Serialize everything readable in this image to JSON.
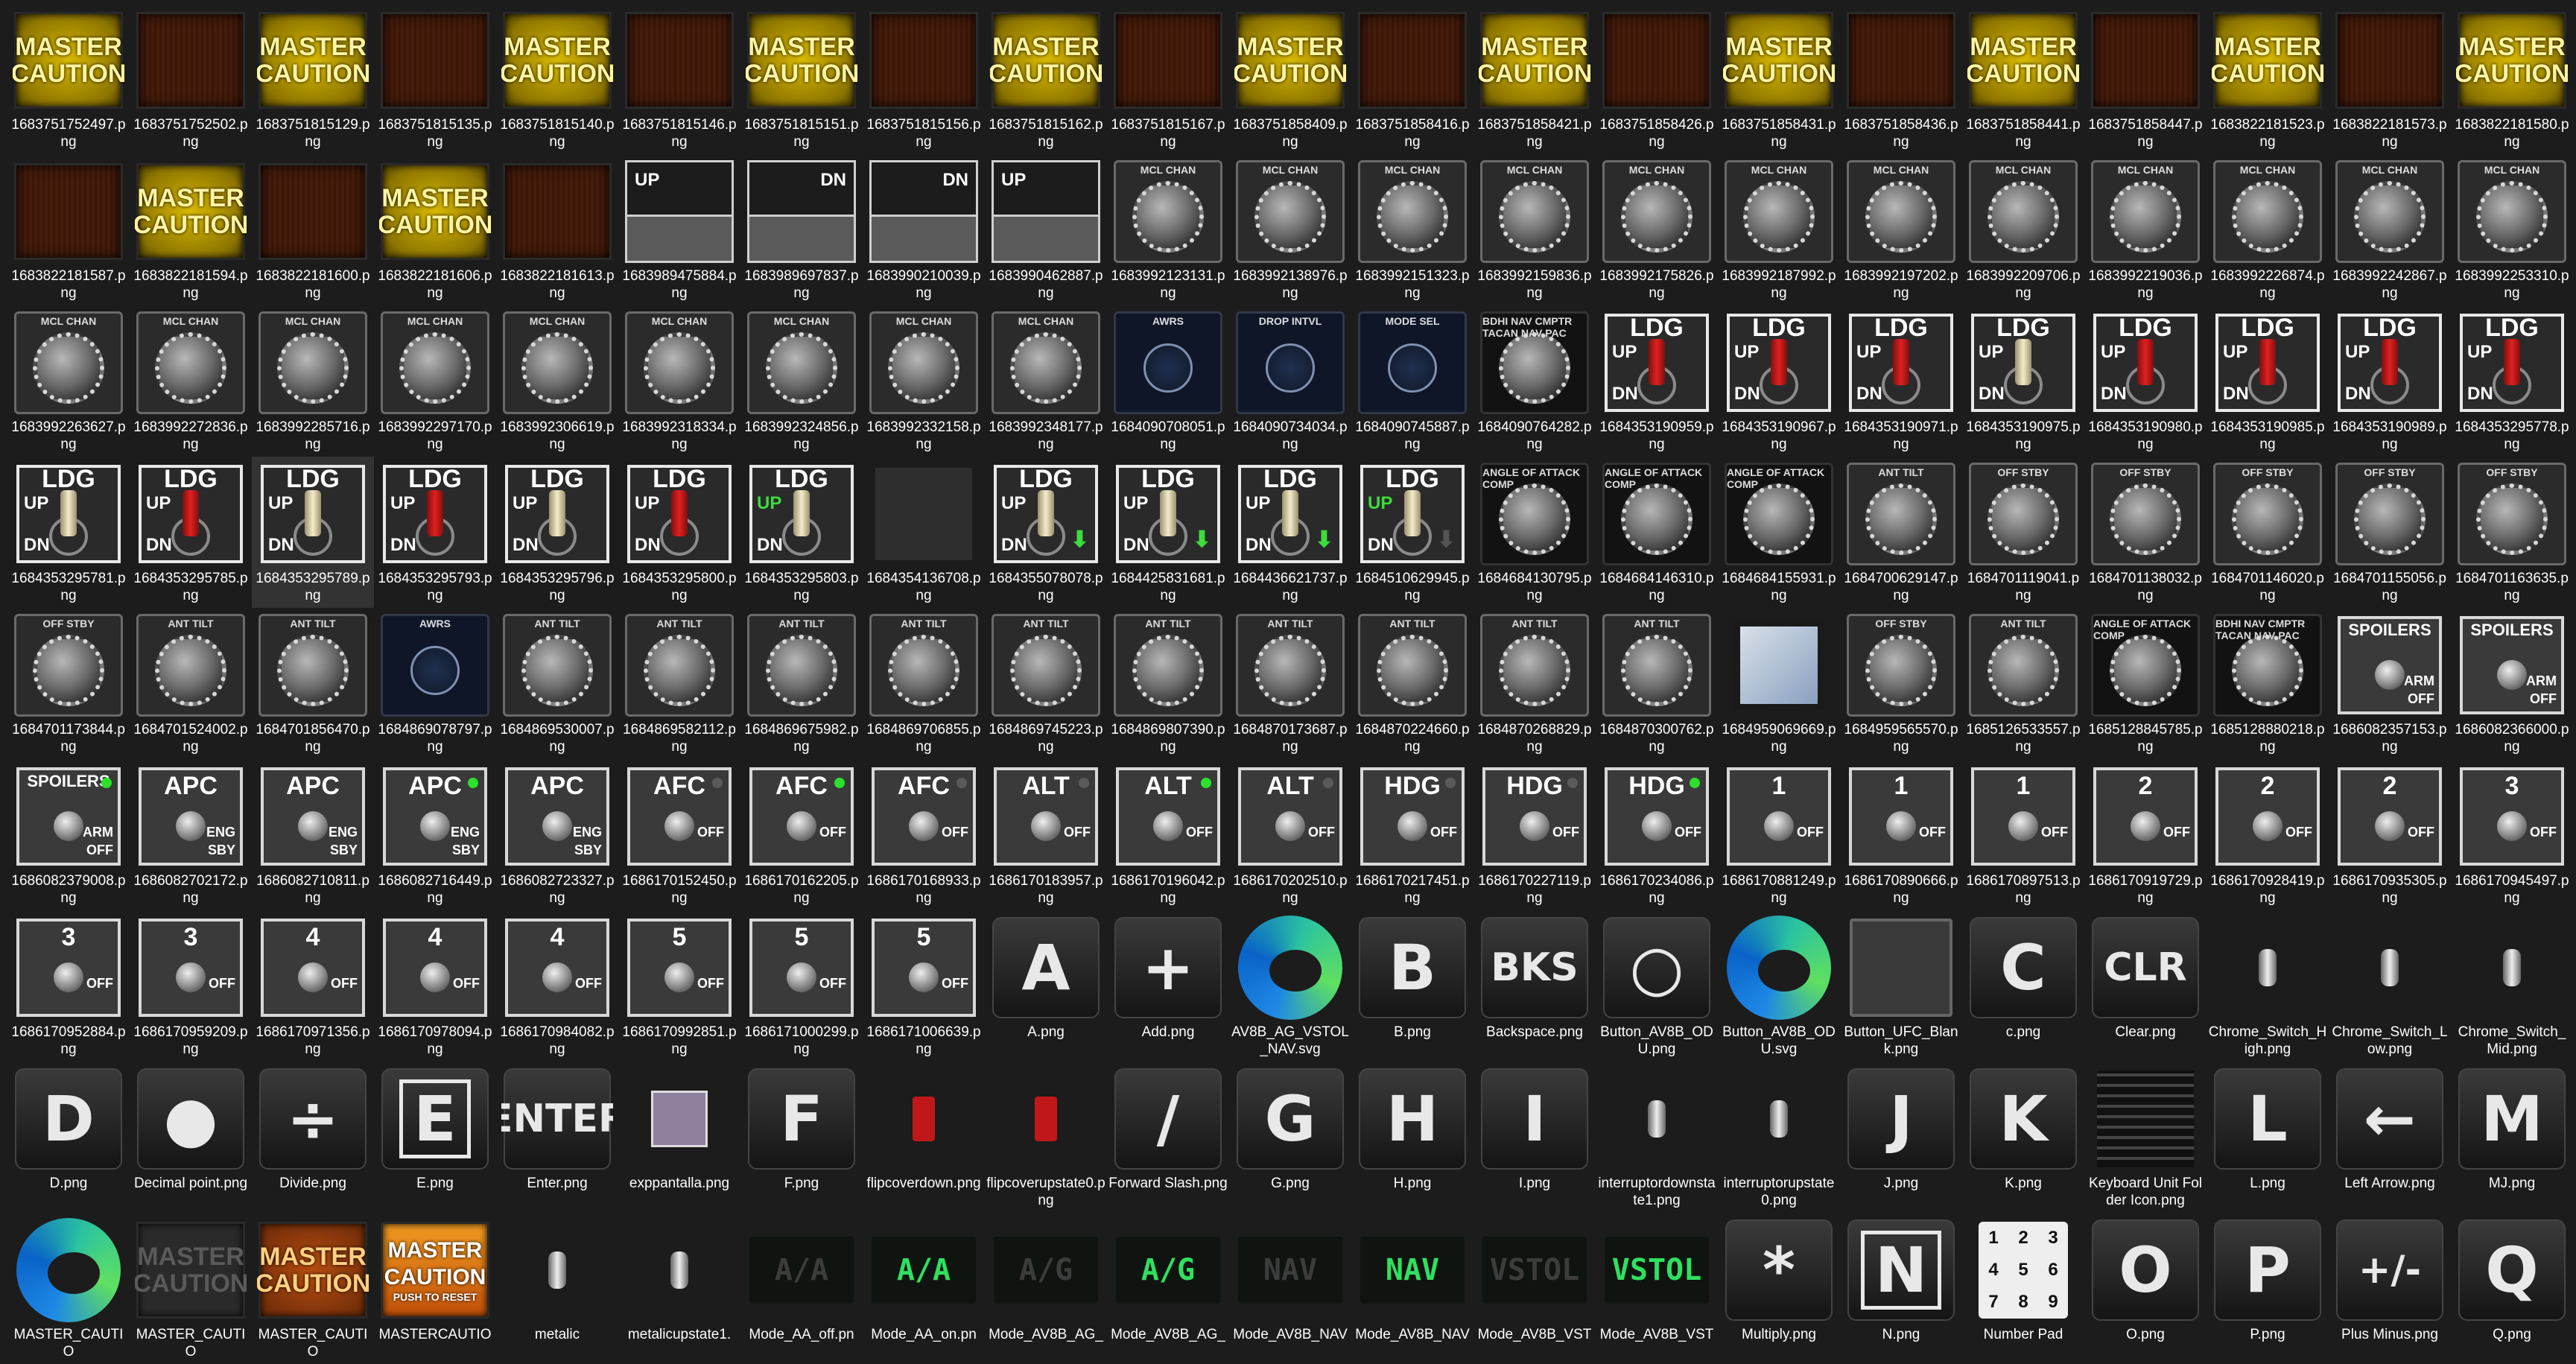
{
  "files": [
    {
      "name": "1683751752497.png",
      "type": "mc-on"
    },
    {
      "name": "1683751752502.png",
      "type": "mc-off"
    },
    {
      "name": "1683751815129.png",
      "type": "mc-on"
    },
    {
      "name": "1683751815135.png",
      "type": "mc-off"
    },
    {
      "name": "1683751815140.png",
      "type": "mc-on"
    },
    {
      "name": "1683751815146.png",
      "type": "mc-off"
    },
    {
      "name": "1683751815151.png",
      "type": "mc-on"
    },
    {
      "name": "1683751815156.png",
      "type": "mc-off"
    },
    {
      "name": "1683751815162.png",
      "type": "mc-on"
    },
    {
      "name": "1683751815167.png",
      "type": "mc-off"
    },
    {
      "name": "1683751858409.png",
      "type": "mc-on"
    },
    {
      "name": "1683751858416.png",
      "type": "mc-off"
    },
    {
      "name": "1683751858421.png",
      "type": "mc-on"
    },
    {
      "name": "1683751858426.png",
      "type": "mc-off"
    },
    {
      "name": "1683751858431.png",
      "type": "mc-on"
    },
    {
      "name": "1683751858436.png",
      "type": "mc-off"
    },
    {
      "name": "1683751858441.png",
      "type": "mc-on"
    },
    {
      "name": "1683751858447.png",
      "type": "mc-off"
    },
    {
      "name": "1683822181523.png",
      "type": "mc-on"
    },
    {
      "name": "1683822181573.png",
      "type": "mc-off"
    },
    {
      "name": "1683822181580.png",
      "type": "mc-on"
    },
    {
      "name": "1683822181587.png",
      "type": "mc-off"
    },
    {
      "name": "1683822181594.png",
      "type": "mc-on"
    },
    {
      "name": "1683822181600.png",
      "type": "mc-off"
    },
    {
      "name": "1683822181606.png",
      "type": "mc-on"
    },
    {
      "name": "1683822181613.png",
      "type": "mc-off"
    },
    {
      "name": "1683989475884.png",
      "type": "lever",
      "txt": "UP",
      "side": "left"
    },
    {
      "name": "1683989697837.png",
      "type": "lever",
      "txt": "DN",
      "side": "right"
    },
    {
      "name": "1683990210039.png",
      "type": "lever",
      "txt": "DN",
      "side": "right"
    },
    {
      "name": "1683990462887.png",
      "type": "lever",
      "txt": "UP",
      "side": "left"
    },
    {
      "name": "1683992123131.png",
      "type": "knob",
      "txt": "MCL CHAN"
    },
    {
      "name": "1683992138976.png",
      "type": "knob",
      "txt": "MCL CHAN"
    },
    {
      "name": "1683992151323.png",
      "type": "knob",
      "txt": "MCL CHAN"
    },
    {
      "name": "1683992159836.png",
      "type": "knob",
      "txt": "MCL CHAN"
    },
    {
      "name": "1683992175826.png",
      "type": "knob",
      "txt": "MCL CHAN"
    },
    {
      "name": "1683992187992.png",
      "type": "knob",
      "txt": "MCL CHAN"
    },
    {
      "name": "1683992197202.png",
      "type": "knob",
      "txt": "MCL CHAN"
    },
    {
      "name": "1683992209706.png",
      "type": "knob",
      "txt": "MCL CHAN"
    },
    {
      "name": "1683992219036.png",
      "type": "knob",
      "txt": "MCL CHAN"
    },
    {
      "name": "1683992226874.png",
      "type": "knob",
      "txt": "MCL CHAN"
    },
    {
      "name": "1683992242867.png",
      "type": "knob",
      "txt": "MCL CHAN"
    },
    {
      "name": "1683992253310.png",
      "type": "knob",
      "txt": "MCL CHAN"
    },
    {
      "name": "1683992263627.png",
      "type": "knob",
      "txt": "MCL CHAN"
    },
    {
      "name": "1683992272836.png",
      "type": "knob",
      "txt": "MCL CHAN"
    },
    {
      "name": "1683992285716.png",
      "type": "knob",
      "txt": "MCL CHAN"
    },
    {
      "name": "1683992297170.png",
      "type": "knob",
      "txt": "MCL CHAN"
    },
    {
      "name": "1683992306619.png",
      "type": "knob",
      "txt": "MCL CHAN"
    },
    {
      "name": "1683992318334.png",
      "type": "knob",
      "txt": "MCL CHAN"
    },
    {
      "name": "1683992324856.png",
      "type": "knob",
      "txt": "MCL CHAN"
    },
    {
      "name": "1683992332158.png",
      "type": "knob",
      "txt": "MCL CHAN"
    },
    {
      "name": "1683992348177.png",
      "type": "knob",
      "txt": "MCL CHAN"
    },
    {
      "name": "1684090708051.png",
      "type": "knob-dark",
      "txt": "AWRS"
    },
    {
      "name": "1684090734034.png",
      "type": "knob-dark",
      "txt": "DROP INTVL"
    },
    {
      "name": "1684090745887.png",
      "type": "knob-dark",
      "txt": "MODE SEL"
    },
    {
      "name": "1684090764282.png",
      "type": "knob-black",
      "txt": "BDHI NAV CMPTR TACAN NAV PAC"
    },
    {
      "name": "1684353190959.png",
      "type": "ldg",
      "bat": "red"
    },
    {
      "name": "1684353190967.png",
      "type": "ldg",
      "bat": "red"
    },
    {
      "name": "1684353190971.png",
      "type": "ldg",
      "bat": "red"
    },
    {
      "name": "1684353190975.png",
      "type": "ldg",
      "bat": "cream"
    },
    {
      "name": "1684353190980.png",
      "type": "ldg",
      "bat": "red"
    },
    {
      "name": "1684353190985.png",
      "type": "ldg",
      "bat": "red"
    },
    {
      "name": "1684353190989.png",
      "type": "ldg",
      "bat": "red"
    },
    {
      "name": "1684353295778.png",
      "type": "ldg",
      "bat": "red"
    },
    {
      "name": "1684353295781.png",
      "type": "ldg",
      "bat": "cream"
    },
    {
      "name": "1684353295785.png",
      "type": "ldg",
      "bat": "red"
    },
    {
      "name": "1684353295789.png",
      "type": "ldg",
      "bat": "cream",
      "selected": true
    },
    {
      "name": "1684353295793.png",
      "type": "ldg",
      "bat": "red"
    },
    {
      "name": "1684353295796.png",
      "type": "ldg",
      "bat": "cream"
    },
    {
      "name": "1684353295800.png",
      "type": "ldg",
      "bat": "red"
    },
    {
      "name": "1684353295803.png",
      "type": "ldg",
      "bat": "cream",
      "green": true
    },
    {
      "name": "1684354136708.png",
      "type": "blank"
    },
    {
      "name": "1684355078078.png",
      "type": "ldg",
      "bat": "cream",
      "arrow": true
    },
    {
      "name": "1684425831681.png",
      "type": "ldg",
      "bat": "cream",
      "arrow": true
    },
    {
      "name": "1684436621737.png",
      "type": "ldg",
      "bat": "cream",
      "arrow": true
    },
    {
      "name": "1684510629945.png",
      "type": "ldg",
      "bat": "cream",
      "green": true,
      "arrow": true,
      "agrey": true
    },
    {
      "name": "1684684130795.png",
      "type": "knob-black",
      "txt": "ANGLE OF ATTACK COMP"
    },
    {
      "name": "1684684146310.png",
      "type": "knob-black",
      "txt": "ANGLE OF ATTACK COMP"
    },
    {
      "name": "1684684155931.png",
      "type": "knob-black",
      "txt": "ANGLE OF ATTACK COMP"
    },
    {
      "name": "1684700629147.png",
      "type": "knob",
      "txt": "ANT TILT"
    },
    {
      "name": "1684701119041.png",
      "type": "knob",
      "txt": "OFF STBY"
    },
    {
      "name": "1684701138032.png",
      "type": "knob",
      "txt": "OFF STBY"
    },
    {
      "name": "1684701146020.png",
      "type": "knob",
      "txt": "OFF STBY"
    },
    {
      "name": "1684701155056.png",
      "type": "knob",
      "txt": "OFF STBY"
    },
    {
      "name": "1684701163635.png",
      "type": "knob",
      "txt": "OFF STBY"
    },
    {
      "name": "1684701173844.png",
      "type": "knob",
      "txt": "OFF STBY"
    },
    {
      "name": "1684701524002.png",
      "type": "knob",
      "txt": "ANT TILT"
    },
    {
      "name": "1684701856470.png",
      "type": "knob",
      "txt": "ANT TILT"
    },
    {
      "name": "1684869078797.png",
      "type": "knob-dark",
      "txt": "AWRS"
    },
    {
      "name": "1684869530007.png",
      "type": "knob",
      "txt": "ANT TILT"
    },
    {
      "name": "1684869582112.png",
      "type": "knob",
      "txt": "ANT TILT"
    },
    {
      "name": "1684869675982.png",
      "type": "knob",
      "txt": "ANT TILT"
    },
    {
      "name": "1684869706855.png",
      "type": "knob",
      "txt": "ANT TILT"
    },
    {
      "name": "1684869745223.png",
      "type": "knob",
      "txt": "ANT TILT"
    },
    {
      "name": "1684869807390.png",
      "type": "knob",
      "txt": "ANT TILT"
    },
    {
      "name": "1684870173687.png",
      "type": "knob",
      "txt": "ANT TILT"
    },
    {
      "name": "1684870224660.png",
      "type": "knob",
      "txt": "ANT TILT"
    },
    {
      "name": "1684870268829.png",
      "type": "knob",
      "txt": "ANT TILT"
    },
    {
      "name": "1684870300762.png",
      "type": "knob",
      "txt": "ANT TILT"
    },
    {
      "name": "1684959069669.png",
      "type": "map"
    },
    {
      "name": "1684959565570.png",
      "type": "knob",
      "txt": "OFF STBY"
    },
    {
      "name": "1685126533557.png",
      "type": "knob",
      "txt": "ANT TILT"
    },
    {
      "name": "1685128845785.png",
      "type": "knob-black",
      "txt": "ANGLE OF ATTACK COMP"
    },
    {
      "name": "1685128880218.png",
      "type": "knob-black",
      "txt": "BDHI NAV CMPTR TACAN NAV PAC"
    },
    {
      "name": "1686082357153.png",
      "type": "panel",
      "txt": "SPOILERS",
      "s1": "ARM",
      "s2": "OFF"
    },
    {
      "name": "1686082366000.png",
      "type": "panel",
      "txt": "SPOILERS",
      "s1": "ARM",
      "s2": "OFF"
    },
    {
      "name": "1686082379008.png",
      "type": "panel",
      "txt": "SPOILERS",
      "s1": "ARM",
      "s2": "OFF",
      "dot": "g"
    },
    {
      "name": "1686082702172.png",
      "type": "panel",
      "txt": "APC",
      "s1": "ENG",
      "s2": "SBY"
    },
    {
      "name": "1686082710811.png",
      "type": "panel",
      "txt": "APC",
      "s1": "ENG",
      "s2": "SBY"
    },
    {
      "name": "1686082716449.png",
      "type": "panel",
      "txt": "APC",
      "s1": "ENG",
      "s2": "SBY",
      "dot": "g"
    },
    {
      "name": "1686082723327.png",
      "type": "panel",
      "txt": "APC",
      "s1": "ENG",
      "s2": "SBY"
    },
    {
      "name": "1686170152450.png",
      "type": "panel",
      "txt": "AFC",
      "s1": "OFF",
      "s2": "",
      "dot": "n"
    },
    {
      "name": "1686170162205.png",
      "type": "panel",
      "txt": "AFC",
      "s1": "OFF",
      "s2": "",
      "dot": "g"
    },
    {
      "name": "1686170168933.png",
      "type": "panel",
      "txt": "AFC",
      "s1": "OFF",
      "s2": "",
      "dot": "n"
    },
    {
      "name": "1686170183957.png",
      "type": "panel",
      "txt": "ALT",
      "s1": "OFF",
      "s2": "",
      "dot": "n"
    },
    {
      "name": "1686170196042.png",
      "type": "panel",
      "txt": "ALT",
      "s1": "OFF",
      "s2": "",
      "dot": "g"
    },
    {
      "name": "1686170202510.png",
      "type": "panel",
      "txt": "ALT",
      "s1": "OFF",
      "s2": "",
      "dot": "n"
    },
    {
      "name": "1686170217451.png",
      "type": "panel",
      "txt": "HDG",
      "s1": "OFF",
      "s2": "",
      "dot": "n"
    },
    {
      "name": "1686170227119.png",
      "type": "panel",
      "txt": "HDG",
      "s1": "OFF",
      "s2": "",
      "dot": "n"
    },
    {
      "name": "1686170234086.png",
      "type": "panel",
      "txt": "HDG",
      "s1": "OFF",
      "s2": "",
      "dot": "g"
    },
    {
      "name": "1686170881249.png",
      "type": "panel",
      "txt": "1",
      "s1": "OFF",
      "s2": ""
    },
    {
      "name": "1686170890666.png",
      "type": "panel",
      "txt": "1",
      "s1": "OFF",
      "s2": ""
    },
    {
      "name": "1686170897513.png",
      "type": "panel",
      "txt": "1",
      "s1": "OFF",
      "s2": ""
    },
    {
      "name": "1686170919729.png",
      "type": "panel",
      "txt": "2",
      "s1": "OFF",
      "s2": ""
    },
    {
      "name": "1686170928419.png",
      "type": "panel",
      "txt": "2",
      "s1": "OFF",
      "s2": ""
    },
    {
      "name": "1686170935305.png",
      "type": "panel",
      "txt": "2",
      "s1": "OFF",
      "s2": ""
    },
    {
      "name": "1686170945497.png",
      "type": "panel",
      "txt": "3",
      "s1": "OFF",
      "s2": ""
    },
    {
      "name": "1686170952884.png",
      "type": "panel",
      "txt": "3",
      "s1": "OFF",
      "s2": ""
    },
    {
      "name": "1686170959209.png",
      "type": "panel",
      "txt": "3",
      "s1": "OFF",
      "s2": ""
    },
    {
      "name": "1686170971356.png",
      "type": "panel",
      "txt": "4",
      "s1": "OFF",
      "s2": ""
    },
    {
      "name": "1686170978094.png",
      "type": "panel",
      "txt": "4",
      "s1": "OFF",
      "s2": ""
    },
    {
      "name": "1686170984082.png",
      "type": "panel",
      "txt": "4",
      "s1": "OFF",
      "s2": ""
    },
    {
      "name": "1686170992851.png",
      "type": "panel",
      "txt": "5",
      "s1": "OFF",
      "s2": ""
    },
    {
      "name": "1686171000299.png",
      "type": "panel",
      "txt": "5",
      "s1": "OFF",
      "s2": ""
    },
    {
      "name": "1686171006639.png",
      "type": "panel",
      "txt": "5",
      "s1": "OFF",
      "s2": ""
    },
    {
      "name": "A.png",
      "type": "key",
      "txt": "A"
    },
    {
      "name": "Add.png",
      "type": "key",
      "txt": "+"
    },
    {
      "name": "AV8B_AG_VSTOL_NAV.svg",
      "type": "edge"
    },
    {
      "name": "B.png",
      "type": "key",
      "txt": "B"
    },
    {
      "name": "Backspace.png",
      "type": "key",
      "txt": "BKS",
      "small": true
    },
    {
      "name": "Button_AV8B_ODU.png",
      "type": "key",
      "txt": "○"
    },
    {
      "name": "Button_AV8B_ODU.svg",
      "type": "edge"
    },
    {
      "name": "Button_UFC_Blank.png",
      "type": "blank-key"
    },
    {
      "name": "c.png",
      "type": "key",
      "txt": "C"
    },
    {
      "name": "Clear.png",
      "type": "key",
      "txt": "CLR",
      "small": true
    },
    {
      "name": "Chrome_Switch_High.png",
      "type": "small-sw"
    },
    {
      "name": "Chrome_Switch_Low.png",
      "type": "small-sw"
    },
    {
      "name": "Chrome_Switch_Mid.png",
      "type": "small-sw"
    },
    {
      "name": "D.png",
      "type": "key",
      "txt": "D"
    },
    {
      "name": "Decimal point.png",
      "type": "key",
      "txt": "●"
    },
    {
      "name": "Divide.png",
      "type": "key",
      "txt": "÷"
    },
    {
      "name": "E.png",
      "type": "key",
      "txt": "E",
      "box": true
    },
    {
      "name": "Enter.png",
      "type": "key",
      "txt": "ENTER",
      "small": true
    },
    {
      "name": "exppantalla.png",
      "type": "purple"
    },
    {
      "name": "F.png",
      "type": "key",
      "txt": "F"
    },
    {
      "name": "flipcoverdown.png",
      "type": "flip"
    },
    {
      "name": "flipcoverupstate0.png",
      "type": "flip"
    },
    {
      "name": "Forward Slash.png",
      "type": "key",
      "txt": "/"
    },
    {
      "name": "G.png",
      "type": "key",
      "txt": "G"
    },
    {
      "name": "H.png",
      "type": "key",
      "txt": "H"
    },
    {
      "name": "I.png",
      "type": "key",
      "txt": "I"
    },
    {
      "name": "interruptordownstate1.png",
      "type": "small-sw"
    },
    {
      "name": "interruptorupstate0.png",
      "type": "small-sw"
    },
    {
      "name": "J.png",
      "type": "key",
      "txt": "J"
    },
    {
      "name": "K.png",
      "type": "key",
      "txt": "K"
    },
    {
      "name": "Keyboard Unit Folder Icon.png",
      "type": "kbd"
    },
    {
      "name": "L.png",
      "type": "key",
      "txt": "L"
    },
    {
      "name": "Left Arrow.png",
      "type": "key",
      "txt": "←"
    },
    {
      "name": "MJ.png",
      "type": "key",
      "txt": "M"
    },
    {
      "name": "MASTER_CAUTIO",
      "type": "edge"
    },
    {
      "name": "MASTER_CAUTIO",
      "type": "mc-on",
      "variant": "mc-grey"
    },
    {
      "name": "MASTER_CAUTIO",
      "type": "mc-on",
      "variant": "mc-orange"
    },
    {
      "name": "MASTERCAUTIO",
      "type": "mc-on",
      "variant": "mc-push",
      "push": "PUSH TO RESET"
    },
    {
      "name": "metalic",
      "type": "small-sw"
    },
    {
      "name": "metalicupstate1.",
      "type": "small-sw"
    },
    {
      "name": "Mode_AA_off.pn",
      "type": "mode",
      "txt": "A/A",
      "state": "off"
    },
    {
      "name": "Mode_AA_on.pn",
      "type": "mode",
      "txt": "A/A",
      "state": "on"
    },
    {
      "name": "Mode_AV8B_AG_",
      "type": "mode",
      "txt": "A/G",
      "state": "off"
    },
    {
      "name": "Mode_AV8B_AG_",
      "type": "mode",
      "txt": "A/G",
      "state": "on"
    },
    {
      "name": "Mode_AV8B_NAV",
      "type": "mode",
      "txt": "NAV",
      "state": "off"
    },
    {
      "name": "Mode_AV8B_NAV",
      "type": "mode",
      "txt": "NAV",
      "state": "on"
    },
    {
      "name": "Mode_AV8B_VST",
      "type": "mode",
      "txt": "VSTOL",
      "state": "off"
    },
    {
      "name": "Mode_AV8B_VST",
      "type": "mode",
      "txt": "VSTOL",
      "state": "on"
    },
    {
      "name": "Multiply.png",
      "type": "key",
      "txt": "*"
    },
    {
      "name": "N.png",
      "type": "key",
      "txt": "N",
      "box": true
    },
    {
      "name": "Number Pad",
      "type": "numpad"
    },
    {
      "name": "O.png",
      "type": "key",
      "txt": "O"
    },
    {
      "name": "P.png",
      "type": "key",
      "txt": "P"
    },
    {
      "name": "Plus Minus.png",
      "type": "key",
      "txt": "+/-",
      "small": true
    },
    {
      "name": "Q.png",
      "type": "key",
      "txt": "Q"
    }
  ],
  "labels": {
    "master": "MASTER",
    "caution": "CAUTION",
    "ldg": "LDG",
    "up": "UP",
    "dn": "DN",
    "numpad": [
      "1",
      "2",
      "3",
      "4",
      "5",
      "6",
      "7",
      "8",
      "9"
    ]
  }
}
